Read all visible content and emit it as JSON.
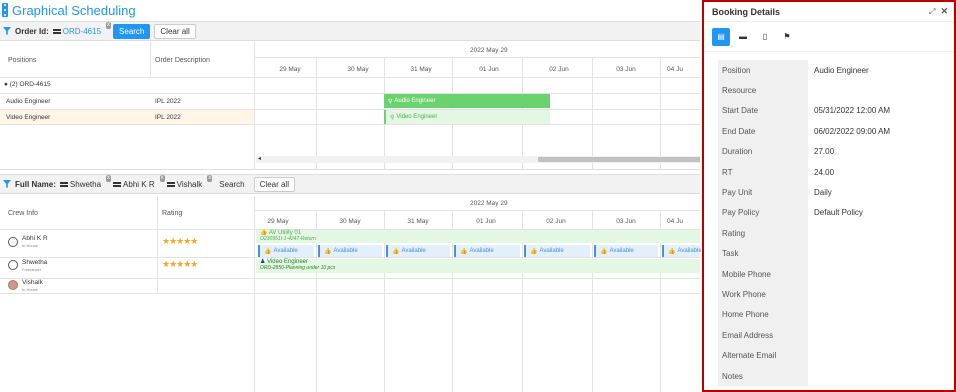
{
  "app": {
    "title": "Graphical Scheduling"
  },
  "order_filter": {
    "label": "Order Id:",
    "chip": "ORD-4615",
    "search_label": "Search",
    "clear_label": "Clear all"
  },
  "order_grid": {
    "col_positions": "Positions",
    "col_description": "Order Description",
    "month_label": "2022 May 29",
    "dates": [
      "29 May",
      "30 May",
      "31 May",
      "01 Jun",
      "02 Jun",
      "03 Jun",
      "04 Ju"
    ],
    "group_label": "(2) ORD-4615",
    "rows": [
      {
        "position": "Audio Engineer",
        "description": "IPL 2022",
        "bar_label": "Audio Engineer"
      },
      {
        "position": "Video Engineer",
        "description": "IPL 2022",
        "bar_label": "Video Engineer"
      }
    ]
  },
  "crew_filter": {
    "label": "Full Name:",
    "chips": [
      "Shwetha",
      "Abhi K R",
      "Vishalk"
    ],
    "search_label": "Search",
    "clear_label": "Clear all"
  },
  "crew_grid": {
    "col_crew": "Crew Info",
    "col_rating": "Rating",
    "month_label": "2022 May 29",
    "dates": [
      "29 May",
      "30 May",
      "31 May",
      "01 Jun",
      "02 Jun",
      "03 Jun",
      "04 Ju"
    ],
    "crew": [
      {
        "name": "Abhi K R",
        "sub": "In House",
        "stars": "★★★★★"
      },
      {
        "name": "Shwetha",
        "sub": "Freelancer",
        "stars": "★★★★★"
      },
      {
        "name": "Vishalk",
        "sub": "In House",
        "stars": ""
      }
    ],
    "utility_title": "AV Utility 01",
    "utility_sub": "O230951I-1-4247-Return",
    "available_label": "Available",
    "video_title": "Video Engineer",
    "video_sub": "ORD-2850-Planning under 10 pcs"
  },
  "panel": {
    "title": "Booking Details",
    "fields": [
      {
        "label": "Position",
        "value": "Audio Engineer"
      },
      {
        "label": "Resource",
        "value": ""
      },
      {
        "label": "Start Date",
        "value": "05/31/2022 12:00 AM"
      },
      {
        "label": "End Date",
        "value": "06/02/2022 09:00 AM"
      },
      {
        "label": "Duration",
        "value": "27.00"
      },
      {
        "label": "RT",
        "value": "24.00"
      },
      {
        "label": "Pay Unit",
        "value": "Daily"
      },
      {
        "label": "Pay Policy",
        "value": "Default Policy"
      },
      {
        "label": "Rating",
        "value": ""
      },
      {
        "label": "Task",
        "value": ""
      },
      {
        "label": "Mobile Phone",
        "value": ""
      },
      {
        "label": "Work Phone",
        "value": ""
      },
      {
        "label": "Home Phone",
        "value": ""
      },
      {
        "label": "Email Address",
        "value": ""
      },
      {
        "label": "Alternate Email",
        "value": ""
      },
      {
        "label": "Notes",
        "value": ""
      }
    ]
  },
  "colors": {
    "accent": "#2196f3",
    "booked": "#6ad36e",
    "panel_border": "#bb0000"
  }
}
